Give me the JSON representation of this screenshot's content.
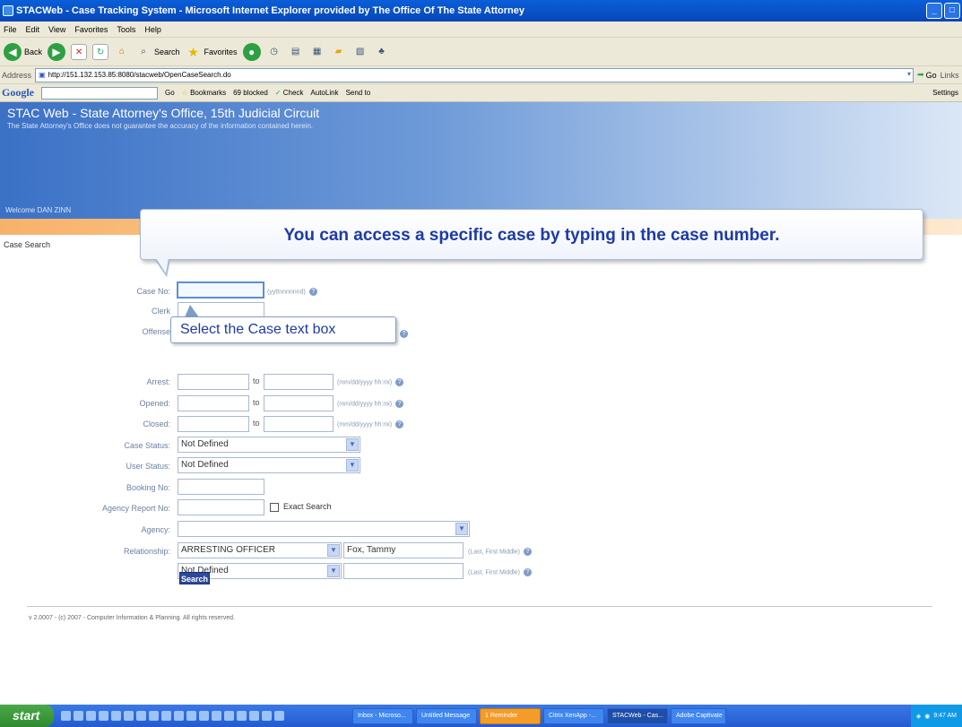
{
  "window": {
    "title": "STACWeb - Case Tracking System - Microsoft Internet Explorer provided by The Office Of The State Attorney"
  },
  "menu": [
    "File",
    "Edit",
    "View",
    "Favorites",
    "Tools",
    "Help"
  ],
  "toolbar": {
    "back": "Back",
    "search": "Search",
    "favorites": "Favorites"
  },
  "address": {
    "label": "Address",
    "url": "http://151.132.153.85:8080/stacweb/OpenCaseSearch.do",
    "go": "Go",
    "links": "Links"
  },
  "google_bar": {
    "logo": "Google",
    "go": "Go",
    "bookmarks": "Bookmarks",
    "blocked": "69 blocked",
    "check": "Check",
    "autolink": "AutoLink",
    "sendto": "Send to",
    "settings": "Settings"
  },
  "page": {
    "title": "STAC Web - State Attorney's Office, 15th Judicial Circuit",
    "disclaimer": "The State Attorney's Office does not guarantee the accuracy of the information contained herein.",
    "welcome": "Welcome DAN ZINN",
    "nav_case_search": "Case Search",
    "footer": "v 2.0007 - (c) 2007 - Computer Information & Planning. All rights reserved."
  },
  "form": {
    "case_no_label": "Case No:",
    "case_no_format": "(yyttnnnnnnd)",
    "clerk_label": "Clerk",
    "offense_label": "Offense",
    "arrest_label": "Arrest:",
    "opened_label": "Opened:",
    "closed_label": "Closed:",
    "to_label": "to",
    "date_format": "(mm/dd/yyyy hh:mi)",
    "case_status_label": "Case Status:",
    "case_status_value": "Not Defined",
    "user_status_label": "User Status:",
    "user_status_value": "Not Defined",
    "booking_label": "Booking No:",
    "agency_report_label": "Agency Report No:",
    "exact_search_label": "Exact Search",
    "agency_label": "Agency:",
    "agency_value": "",
    "relationship_label": "Relationship:",
    "relationship1_value": "ARRESTING OFFICER",
    "relationship1_name": "Fox, Tammy",
    "relationship2_value": "Not Defined",
    "relationship2_name": "",
    "name_format": "(Last, First Middle)",
    "search_button": "Search"
  },
  "callouts": {
    "main": "You can access a specific case by typing in the case number.",
    "hint": "Select the Case text box"
  },
  "taskbar": {
    "start": "start",
    "tasks": [
      "Inbox - Microso...",
      "Untitled Message",
      "1 Reminder",
      "Citrix XenApp -...",
      "STACWeb - Cas...",
      "Adobe Captivate"
    ],
    "clock": "9:47 AM"
  },
  "colors": {
    "accent": "#1d3aa8",
    "header": "#3b71c6",
    "orange_band": "#f7b26a"
  }
}
